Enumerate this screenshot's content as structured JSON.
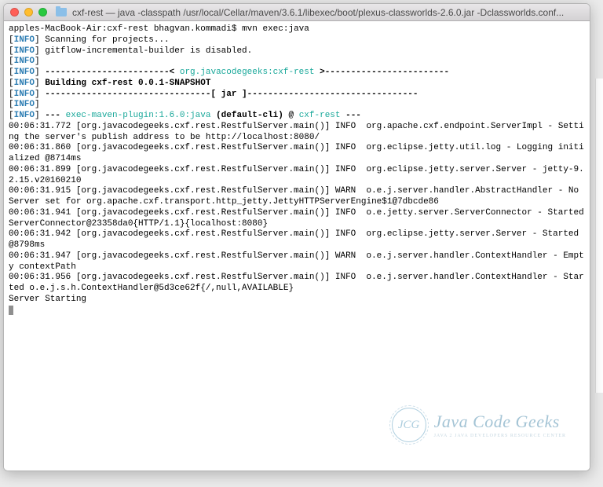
{
  "titlebar": {
    "title": "cxf-rest — java -classpath /usr/local/Cellar/maven/3.6.1/libexec/boot/plexus-classworlds-2.6.0.jar -Dclassworlds.conf..."
  },
  "prompt": {
    "host": "apples-MacBook-Air:cxf-rest bhagvan.kommadi$ ",
    "command": "mvn exec:java"
  },
  "labels": {
    "info": "INFO",
    "warn": "WARN"
  },
  "lines": {
    "scanning": "Scanning for projects...",
    "gitflow": "gitflow-incremental-builder is disabled.",
    "divider_pre": "------------------------< ",
    "project_ga": "org.javacodegeeks:cxf-rest",
    "divider_post": " >------------------------",
    "building": "Building cxf-rest 0.0.1-SNAPSHOT",
    "jar_line": "--------------------------------[ jar ]---------------------------------",
    "exec_pre": "--- ",
    "exec_plugin": "exec-maven-plugin:1.6.0:java",
    "exec_mid": " (default-cli) @ ",
    "exec_artifact": "cxf-rest",
    "exec_post": " ---",
    "log1": "00:06:31.772 [org.javacodegeeks.cxf.rest.RestfulServer.main()] INFO  org.apache.cxf.endpoint.ServerImpl - Setting the server's publish address to be http://localhost:8080/",
    "log2": "00:06:31.860 [org.javacodegeeks.cxf.rest.RestfulServer.main()] INFO  org.eclipse.jetty.util.log - Logging initialized @8714ms",
    "log3": "00:06:31.899 [org.javacodegeeks.cxf.rest.RestfulServer.main()] INFO  org.eclipse.jetty.server.Server - jetty-9.2.15.v20160210",
    "log4": "00:06:31.915 [org.javacodegeeks.cxf.rest.RestfulServer.main()] WARN  o.e.j.server.handler.AbstractHandler - No Server set for org.apache.cxf.transport.http_jetty.JettyHTTPServerEngine$1@7dbcde86",
    "log5": "00:06:31.941 [org.javacodegeeks.cxf.rest.RestfulServer.main()] INFO  o.e.jetty.server.ServerConnector - Started ServerConnector@23358da0{HTTP/1.1}{localhost:8080}",
    "log6": "00:06:31.942 [org.javacodegeeks.cxf.rest.RestfulServer.main()] INFO  org.eclipse.jetty.server.Server - Started @8798ms",
    "log7": "00:06:31.947 [org.javacodegeeks.cxf.rest.RestfulServer.main()] WARN  o.e.j.server.handler.ContextHandler - Empty contextPath",
    "log8": "00:06:31.956 [org.javacodegeeks.cxf.rest.RestfulServer.main()] INFO  o.e.j.server.handler.ContextHandler - Started o.e.j.s.h.ContextHandler@5d3ce62f{/,null,AVAILABLE}",
    "server_starting": "Server Starting"
  },
  "watermark": {
    "logo_text": "JCG",
    "title": "Java Code Geeks",
    "subtitle": "JAVA 2 JAVA DEVELOPERS RESOURCE CENTER"
  }
}
